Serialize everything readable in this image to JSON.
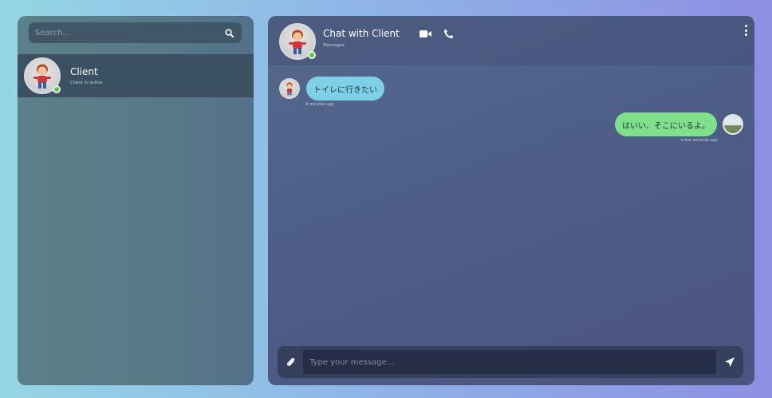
{
  "sidebar": {
    "search": {
      "placeholder": "Search...",
      "value": ""
    },
    "contacts": [
      {
        "name": "Client",
        "status": "Client is online",
        "online": true
      }
    ]
  },
  "chat": {
    "title": "Chat with Client",
    "subtitle": "Messages",
    "header_icons": [
      "video-camera-icon",
      "phone-icon",
      "more-vertical-icon"
    ],
    "messages": [
      {
        "direction": "incoming",
        "text": "トイレに行きたい",
        "time": "4 minutes ago"
      },
      {
        "direction": "outgoing",
        "text": "はいい、そこにいるよ。",
        "time": "a few seconds ago"
      }
    ],
    "composer": {
      "placeholder": "Type your message...",
      "value": ""
    }
  },
  "colors": {
    "online": "#4cd137",
    "incoming_bubble": "#7ed0e7",
    "outgoing_bubble": "#7ee08b"
  }
}
